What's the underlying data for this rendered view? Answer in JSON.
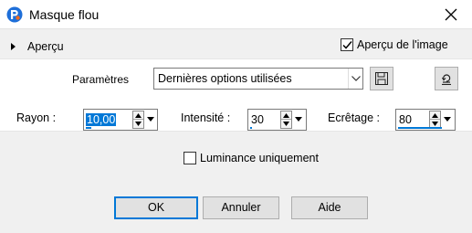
{
  "window": {
    "title": "Masque flou",
    "app_icon": "paintshop-pro-icon"
  },
  "preview": {
    "toggle_label": "Aperçu",
    "image_preview_label": "Aperçu de l'image",
    "image_preview_checked": true
  },
  "settings": {
    "label": "Paramètres",
    "preset_value": "Dernières options utilisées",
    "save_icon": "save-icon",
    "reset_icon": "reset-defaults-icon"
  },
  "fields": {
    "radius": {
      "label": "Rayon :",
      "value": "10,00"
    },
    "intensity": {
      "label": "Intensité :",
      "value": "30"
    },
    "clipping": {
      "label": "Ecrêtage :",
      "value": "80"
    }
  },
  "luminance": {
    "label": "Luminance uniquement",
    "checked": false
  },
  "buttons": {
    "ok": "OK",
    "cancel": "Annuler",
    "help": "Aide"
  },
  "colors": {
    "accent": "#0078d7",
    "title_bg": "#ffffff",
    "dialog_bg": "#f0f0f0"
  }
}
